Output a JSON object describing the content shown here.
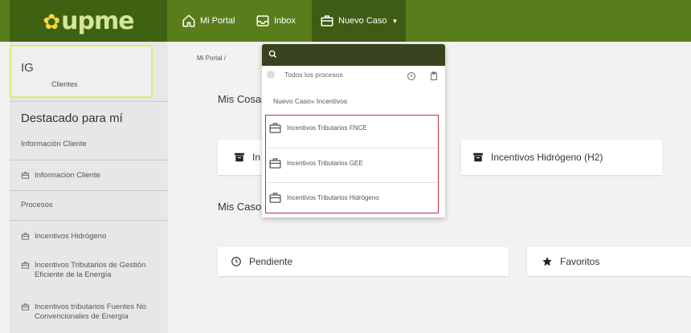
{
  "header": {
    "logo": "upme",
    "nav": [
      {
        "label": "Mi Portal",
        "icon": "home-icon"
      },
      {
        "label": "Inbox",
        "icon": "inbox-icon"
      },
      {
        "label": "Nuevo Caso",
        "icon": "case-icon"
      }
    ]
  },
  "sidebar": {
    "client_initials": "IG",
    "client_label": "Clientes",
    "section_title": "Destacado para mí",
    "info_label": "Información Cliente",
    "info_item": "Informacion Cliente",
    "processes_label": "Procesos",
    "items": [
      {
        "label": "Incentivos Hidrógeno"
      },
      {
        "label": "Incentivos Tributarios de Gestión Eficiente de la Energía"
      },
      {
        "label": "Incentivos tributarios Fuentes No Convencionales de Energía"
      }
    ]
  },
  "main": {
    "breadcrumb": "Mi Portal /",
    "mis_cosas": "Mis Cosa",
    "mis_casos": "Mis Caso",
    "cards": {
      "in_partial": "In",
      "hidrogeno": "Incentivos Hidrógeno (H2)",
      "pendiente": "Pendiente",
      "favoritos": "Favoritos"
    }
  },
  "dropdown": {
    "search_placeholder": "",
    "all_label": "Todos los procesos",
    "header": "Nuevo Caso» Incentivos",
    "items": [
      {
        "label": "Incentivos Tributarios FNCE"
      },
      {
        "label": "Incentivos Tributarios GEE"
      },
      {
        "label": "Incentivos Tributarios Hidrógeno"
      }
    ]
  },
  "colors": {
    "header_green": "#5a7d1c",
    "logo_bg": "#3f6212",
    "active_nav": "#3f5c14",
    "search_bar": "#3a4320",
    "highlight_red": "#c0313a",
    "client_card_border": "#d9ec77"
  }
}
